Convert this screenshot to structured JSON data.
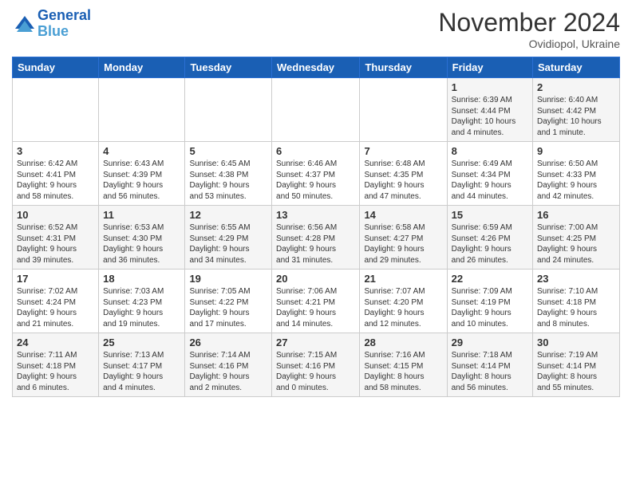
{
  "header": {
    "logo_line1": "General",
    "logo_line2": "Blue",
    "month": "November 2024",
    "location": "Ovidiopol, Ukraine"
  },
  "weekdays": [
    "Sunday",
    "Monday",
    "Tuesday",
    "Wednesday",
    "Thursday",
    "Friday",
    "Saturday"
  ],
  "weeks": [
    [
      {
        "day": "",
        "info": ""
      },
      {
        "day": "",
        "info": ""
      },
      {
        "day": "",
        "info": ""
      },
      {
        "day": "",
        "info": ""
      },
      {
        "day": "",
        "info": ""
      },
      {
        "day": "1",
        "info": "Sunrise: 6:39 AM\nSunset: 4:44 PM\nDaylight: 10 hours\nand 4 minutes."
      },
      {
        "day": "2",
        "info": "Sunrise: 6:40 AM\nSunset: 4:42 PM\nDaylight: 10 hours\nand 1 minute."
      }
    ],
    [
      {
        "day": "3",
        "info": "Sunrise: 6:42 AM\nSunset: 4:41 PM\nDaylight: 9 hours\nand 58 minutes."
      },
      {
        "day": "4",
        "info": "Sunrise: 6:43 AM\nSunset: 4:39 PM\nDaylight: 9 hours\nand 56 minutes."
      },
      {
        "day": "5",
        "info": "Sunrise: 6:45 AM\nSunset: 4:38 PM\nDaylight: 9 hours\nand 53 minutes."
      },
      {
        "day": "6",
        "info": "Sunrise: 6:46 AM\nSunset: 4:37 PM\nDaylight: 9 hours\nand 50 minutes."
      },
      {
        "day": "7",
        "info": "Sunrise: 6:48 AM\nSunset: 4:35 PM\nDaylight: 9 hours\nand 47 minutes."
      },
      {
        "day": "8",
        "info": "Sunrise: 6:49 AM\nSunset: 4:34 PM\nDaylight: 9 hours\nand 44 minutes."
      },
      {
        "day": "9",
        "info": "Sunrise: 6:50 AM\nSunset: 4:33 PM\nDaylight: 9 hours\nand 42 minutes."
      }
    ],
    [
      {
        "day": "10",
        "info": "Sunrise: 6:52 AM\nSunset: 4:31 PM\nDaylight: 9 hours\nand 39 minutes."
      },
      {
        "day": "11",
        "info": "Sunrise: 6:53 AM\nSunset: 4:30 PM\nDaylight: 9 hours\nand 36 minutes."
      },
      {
        "day": "12",
        "info": "Sunrise: 6:55 AM\nSunset: 4:29 PM\nDaylight: 9 hours\nand 34 minutes."
      },
      {
        "day": "13",
        "info": "Sunrise: 6:56 AM\nSunset: 4:28 PM\nDaylight: 9 hours\nand 31 minutes."
      },
      {
        "day": "14",
        "info": "Sunrise: 6:58 AM\nSunset: 4:27 PM\nDaylight: 9 hours\nand 29 minutes."
      },
      {
        "day": "15",
        "info": "Sunrise: 6:59 AM\nSunset: 4:26 PM\nDaylight: 9 hours\nand 26 minutes."
      },
      {
        "day": "16",
        "info": "Sunrise: 7:00 AM\nSunset: 4:25 PM\nDaylight: 9 hours\nand 24 minutes."
      }
    ],
    [
      {
        "day": "17",
        "info": "Sunrise: 7:02 AM\nSunset: 4:24 PM\nDaylight: 9 hours\nand 21 minutes."
      },
      {
        "day": "18",
        "info": "Sunrise: 7:03 AM\nSunset: 4:23 PM\nDaylight: 9 hours\nand 19 minutes."
      },
      {
        "day": "19",
        "info": "Sunrise: 7:05 AM\nSunset: 4:22 PM\nDaylight: 9 hours\nand 17 minutes."
      },
      {
        "day": "20",
        "info": "Sunrise: 7:06 AM\nSunset: 4:21 PM\nDaylight: 9 hours\nand 14 minutes."
      },
      {
        "day": "21",
        "info": "Sunrise: 7:07 AM\nSunset: 4:20 PM\nDaylight: 9 hours\nand 12 minutes."
      },
      {
        "day": "22",
        "info": "Sunrise: 7:09 AM\nSunset: 4:19 PM\nDaylight: 9 hours\nand 10 minutes."
      },
      {
        "day": "23",
        "info": "Sunrise: 7:10 AM\nSunset: 4:18 PM\nDaylight: 9 hours\nand 8 minutes."
      }
    ],
    [
      {
        "day": "24",
        "info": "Sunrise: 7:11 AM\nSunset: 4:18 PM\nDaylight: 9 hours\nand 6 minutes."
      },
      {
        "day": "25",
        "info": "Sunrise: 7:13 AM\nSunset: 4:17 PM\nDaylight: 9 hours\nand 4 minutes."
      },
      {
        "day": "26",
        "info": "Sunrise: 7:14 AM\nSunset: 4:16 PM\nDaylight: 9 hours\nand 2 minutes."
      },
      {
        "day": "27",
        "info": "Sunrise: 7:15 AM\nSunset: 4:16 PM\nDaylight: 9 hours\nand 0 minutes."
      },
      {
        "day": "28",
        "info": "Sunrise: 7:16 AM\nSunset: 4:15 PM\nDaylight: 8 hours\nand 58 minutes."
      },
      {
        "day": "29",
        "info": "Sunrise: 7:18 AM\nSunset: 4:14 PM\nDaylight: 8 hours\nand 56 minutes."
      },
      {
        "day": "30",
        "info": "Sunrise: 7:19 AM\nSunset: 4:14 PM\nDaylight: 8 hours\nand 55 minutes."
      }
    ]
  ]
}
